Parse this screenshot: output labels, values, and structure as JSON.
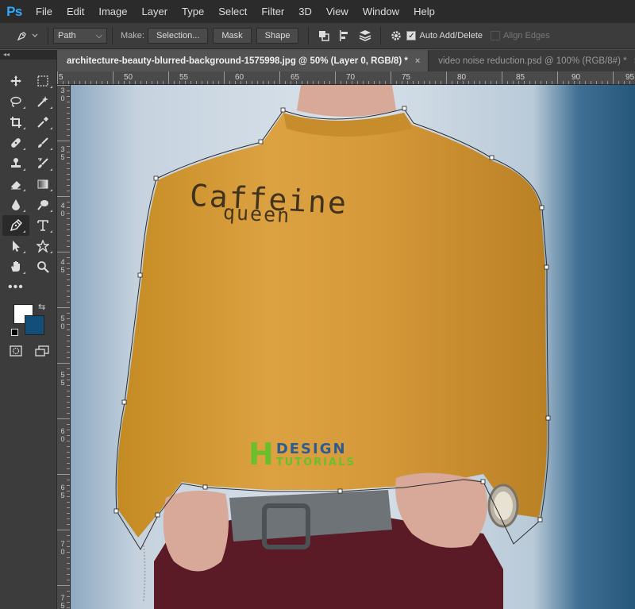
{
  "app": {
    "logo": "Ps"
  },
  "menu": [
    "File",
    "Edit",
    "Image",
    "Layer",
    "Type",
    "Select",
    "Filter",
    "3D",
    "View",
    "Window",
    "Help"
  ],
  "options": {
    "mode_select": "Path",
    "make_label": "Make:",
    "selection_btn": "Selection...",
    "mask_btn": "Mask",
    "shape_btn": "Shape",
    "auto_add_delete": {
      "label": "Auto Add/Delete",
      "checked": true
    },
    "align_edges": {
      "label": "Align Edges",
      "checked": false
    }
  },
  "tabs": [
    {
      "label": "architecture-beauty-blurred-background-1575998.jpg @ 50% (Layer 0, RGB/8) *",
      "active": true,
      "close": "×"
    },
    {
      "label": "video noise reduction.psd @ 100% (RGB/8#) *",
      "active": false,
      "close": "×"
    }
  ],
  "panel_header": "◂◂",
  "tools": [
    [
      "move-tool-icon",
      "marquee-tool-icon"
    ],
    [
      "lasso-tool-icon",
      "magic-wand-tool-icon"
    ],
    [
      "crop-tool-icon",
      "eyedropper-tool-icon"
    ],
    [
      "healing-brush-tool-icon",
      "brush-tool-icon"
    ],
    [
      "clone-stamp-tool-icon",
      "history-brush-tool-icon"
    ],
    [
      "eraser-tool-icon",
      "gradient-tool-icon"
    ],
    [
      "blur-tool-icon",
      "dodge-tool-icon"
    ],
    [
      "pen-tool-icon",
      "type-tool-icon"
    ],
    [
      "path-selection-tool-icon",
      "custom-shape-tool-icon"
    ],
    [
      "hand-tool-icon",
      "zoom-tool-icon"
    ]
  ],
  "active_tool": "pen-tool-icon",
  "toolbar_more": "•••",
  "swatches": {
    "foreground": "#ffffff",
    "background": "#124e78",
    "swap": "⇆"
  },
  "ruler_top": [
    "5",
    "50",
    "55",
    "60",
    "65",
    "70",
    "75",
    "80",
    "85",
    "90",
    "95"
  ],
  "ruler_left": [
    "3",
    "0",
    "3",
    "5",
    "4",
    "0",
    "4",
    "5",
    "5",
    "0",
    "5",
    "5",
    "6",
    "0",
    "6",
    "5",
    "7",
    "0",
    "7",
    "5"
  ],
  "canvas": {
    "shirt_line1": "Caffeine",
    "shirt_line2": "queen",
    "watermark_h": "H",
    "watermark_top": "DESIGN",
    "watermark_bottom": "TUTORIALS"
  },
  "colors": {
    "shirt": "#d49a2e",
    "pants": "#5a1a26",
    "skin": "#d8a898",
    "belt": "#6e7378",
    "background_left": "#9fb5c8",
    "background_right": "#2e5f84"
  }
}
